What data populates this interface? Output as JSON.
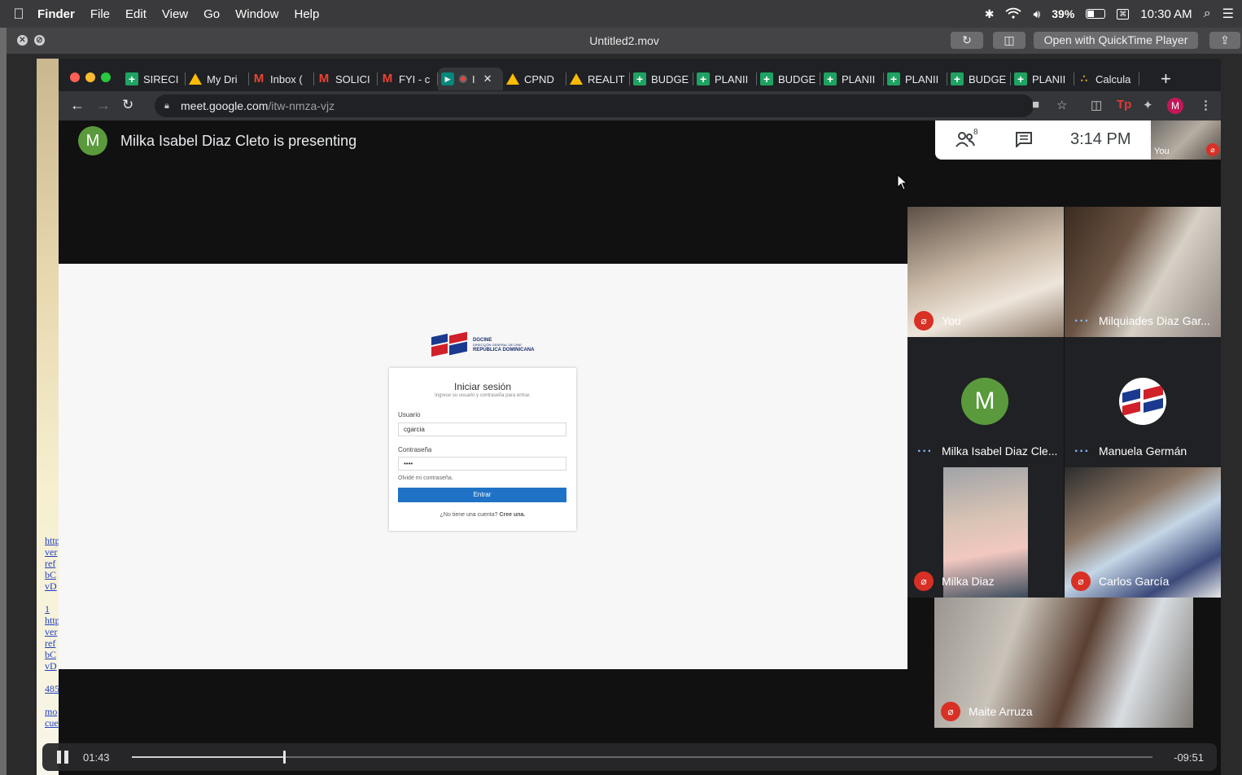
{
  "menubar": {
    "app": "Finder",
    "items": [
      "File",
      "Edit",
      "View",
      "Go",
      "Window",
      "Help"
    ],
    "battery": "39%",
    "clock": "10:30 AM"
  },
  "qt": {
    "title": "Untitled2.mov",
    "open_with": "Open with QuickTime Player"
  },
  "desktop_links": [
    "http",
    "ver",
    "ref",
    "bC",
    "vD",
    "",
    "1",
    "http",
    "ver",
    "ref",
    "bC",
    "vD",
    "",
    "485",
    "",
    "mo",
    "cue"
  ],
  "chrome": {
    "tabs": [
      {
        "label": "SIRECI",
        "icon": "sheets"
      },
      {
        "label": "My Dri",
        "icon": "drive"
      },
      {
        "label": "Inbox (",
        "icon": "gmail"
      },
      {
        "label": "SOLICI",
        "icon": "gmail"
      },
      {
        "label": "FYI - c",
        "icon": "gmail"
      },
      {
        "label": "I",
        "icon": "meet",
        "active": true
      },
      {
        "label": "CPND",
        "icon": "drive"
      },
      {
        "label": "REALIT",
        "icon": "drive"
      },
      {
        "label": "BUDGE",
        "icon": "sheets"
      },
      {
        "label": "PLANII",
        "icon": "sheets"
      },
      {
        "label": "BUDGE",
        "icon": "sheets"
      },
      {
        "label": "PLANII",
        "icon": "sheets"
      },
      {
        "label": "PLANII",
        "icon": "sheets"
      },
      {
        "label": "BUDGE",
        "icon": "sheets"
      },
      {
        "label": "PLANII",
        "icon": "sheets"
      },
      {
        "label": "Calcula",
        "icon": "calc"
      }
    ],
    "url_host": "meet.google.com",
    "url_path": "/itw-nmza-vjz",
    "profile_initial": "M"
  },
  "meet": {
    "presenter_initial": "M",
    "presenting_text": "Milka Isabel Diaz Cleto is presenting",
    "participant_count": "8",
    "time": "3:14 PM",
    "self_label": "You",
    "tiles": [
      {
        "name": "You",
        "status": "muted"
      },
      {
        "name": "Milquiades Diaz Gar...",
        "status": "active"
      },
      {
        "name": "Milka Isabel Diaz Cle...",
        "status": "active",
        "initial": "M"
      },
      {
        "name": "Manuela Germán",
        "status": "active"
      },
      {
        "name": "Milka Diaz",
        "status": "muted"
      },
      {
        "name": "Carlos García",
        "status": "muted"
      },
      {
        "name": "Maite Arruza",
        "status": "muted"
      }
    ]
  },
  "login": {
    "org_short": "DGCINE",
    "org_line1": "DIRECCIÓN GENERAL DE CINE",
    "org_line2": "REPÚBLICA DOMINICANA",
    "title": "Iniciar sesión",
    "subtitle": "Ingrese su usuario y contraseña para entrar.",
    "user_label": "Usuario",
    "user_value": "cgarcia",
    "pass_label": "Contraseña",
    "pass_value": "••••",
    "forgot": "Olvidé mi contraseña.",
    "submit": "Entrar",
    "no_account": "¿No tiene una cuenta?",
    "create": "Cree una."
  },
  "player": {
    "elapsed": "01:43",
    "remaining": "-09:51",
    "progress": 0.149
  }
}
